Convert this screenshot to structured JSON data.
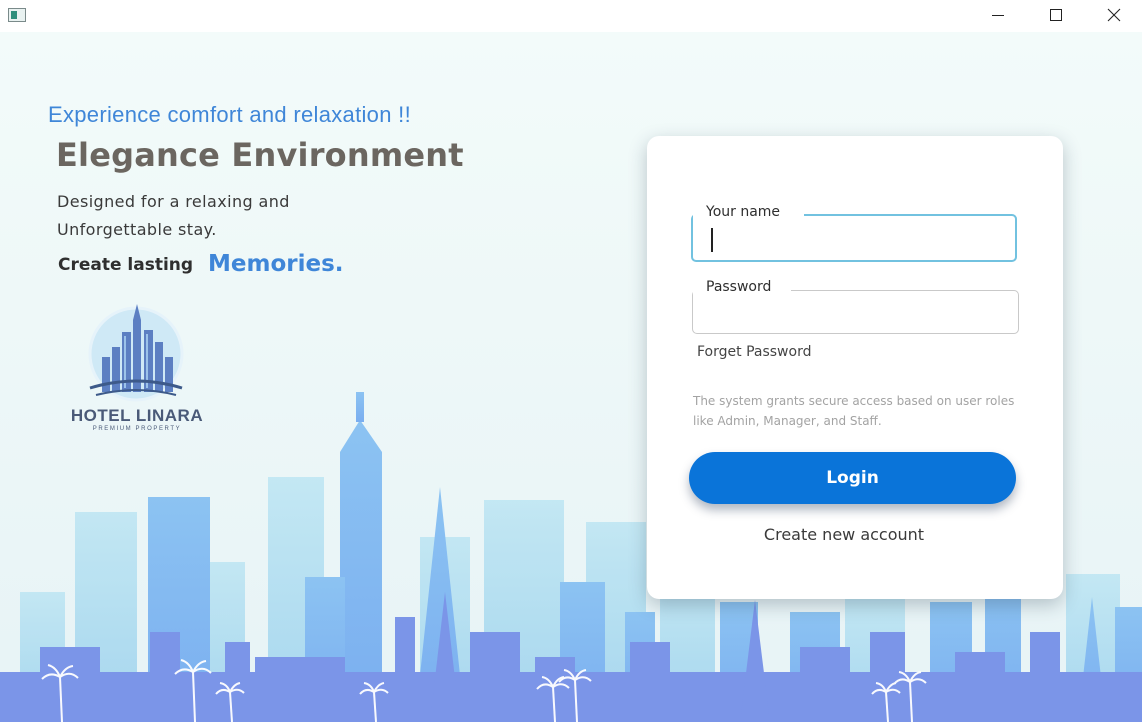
{
  "window": {
    "icon": "app-window-icon",
    "controls": {
      "minimize": "minimize-icon",
      "maximize": "maximize-icon",
      "close": "close-icon"
    }
  },
  "hero": {
    "tagline": "Experience comfort and relaxation !!",
    "headline": "Elegance Environment",
    "description_line1": "Designed for a relaxing and",
    "description_line2": "Unforgettable stay.",
    "lasting": "Create lasting",
    "memories": "Memories."
  },
  "logo": {
    "name": "HOTEL LINARA",
    "subtitle": "PREMIUM PROPERTY"
  },
  "login": {
    "name_label": "Your name",
    "name_value": "",
    "password_label": "Password",
    "password_value": "",
    "forget_password": "Forget Password",
    "info_line1": "The system grants secure access based on user roles",
    "info_line2": "like Admin, Manager, and Staff.",
    "login_button": "Login",
    "create_account": "Create new account"
  },
  "colors": {
    "accent": "#3f86d8",
    "button": "#0a74d9",
    "focus_border": "#72c2e0",
    "skyline_light": "#a9dbef",
    "skyline_mid": "#7fb6f0",
    "skyline_dark": "#6f8fea"
  }
}
